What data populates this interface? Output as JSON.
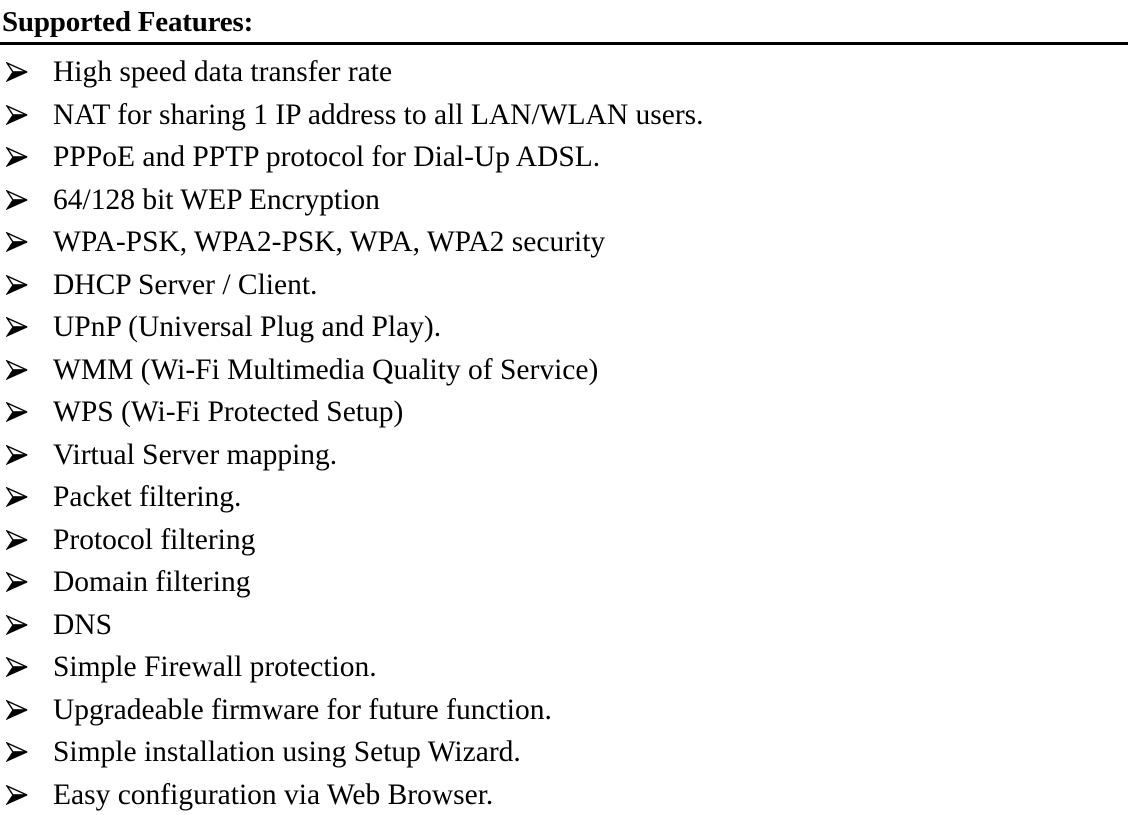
{
  "section": {
    "heading": "Supported Features:",
    "bullet_icon": "arrow-bullet-icon",
    "features": [
      "High speed data transfer rate",
      "NAT for sharing 1 IP address to all LAN/WLAN users.",
      "PPPoE and PPTP protocol for Dial-Up ADSL.",
      "64/128 bit WEP Encryption",
      "WPA-PSK, WPA2-PSK, WPA, WPA2 security",
      "DHCP Server / Client.",
      "UPnP (Universal Plug and Play).",
      "WMM (Wi-Fi Multimedia Quality of Service)",
      "WPS (Wi-Fi Protected Setup)",
      "Virtual Server mapping.",
      "Packet filtering.",
      "Protocol filtering",
      "Domain filtering",
      "DNS",
      "Simple Firewall protection.",
      "Upgradeable firmware for future function.",
      "Simple installation using Setup Wizard.",
      "Easy configuration via Web Browser."
    ]
  }
}
